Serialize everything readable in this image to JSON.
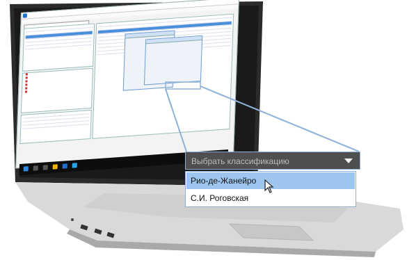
{
  "dropdown": {
    "placeholder": "Выбрать классификацию",
    "options": [
      "Рио-де-Жанейро",
      "С.И. Роговская"
    ],
    "selected_index": 0
  },
  "colors": {
    "dropdown_header": "#4f4f4f",
    "highlight": "#9cc6ee",
    "border_accent": "#8db1da",
    "taskbar": "#0d0d0d"
  },
  "icons": [
    "chevron-down-icon",
    "mouse-pointer-icon",
    "windows-start-icon"
  ]
}
